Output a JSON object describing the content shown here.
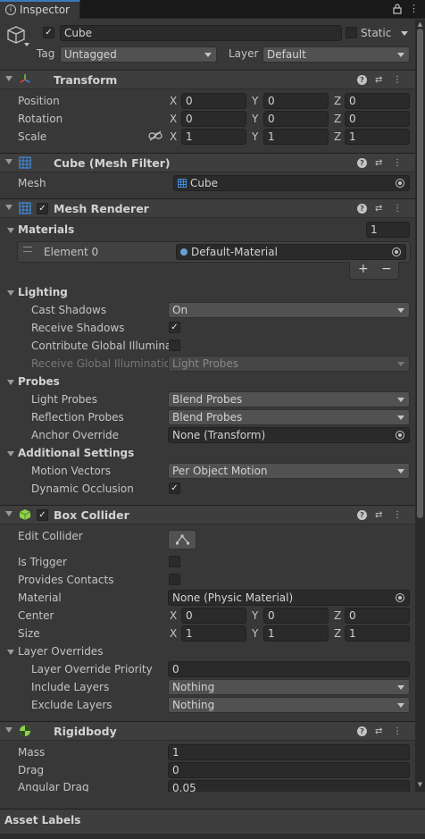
{
  "tab": {
    "title": "Inspector"
  },
  "header": {
    "object_name": "Cube",
    "static_label": "Static",
    "tag_label": "Tag",
    "tag_value": "Untagged",
    "layer_label": "Layer",
    "layer_value": "Default"
  },
  "transform": {
    "title": "Transform",
    "rows": [
      {
        "label": "Position",
        "x": "0",
        "y": "0",
        "z": "0"
      },
      {
        "label": "Rotation",
        "x": "0",
        "y": "0",
        "z": "0"
      },
      {
        "label": "Scale",
        "x": "1",
        "y": "1",
        "z": "1"
      }
    ]
  },
  "axes": {
    "x": "X",
    "y": "Y",
    "z": "Z"
  },
  "mesh_filter": {
    "title": "Cube (Mesh Filter)",
    "mesh_label": "Mesh",
    "mesh_value": "Cube"
  },
  "mesh_renderer": {
    "title": "Mesh Renderer",
    "materials_label": "Materials",
    "materials_count": "1",
    "element_label": "Element 0",
    "element_value": "Default-Material",
    "add": "+",
    "remove": "−",
    "lighting_label": "Lighting",
    "cast_shadows_label": "Cast Shadows",
    "cast_shadows_value": "On",
    "receive_shadows_label": "Receive Shadows",
    "contribute_gi_label": "Contribute Global Illuminati",
    "receive_gi_label": "Receive Global Illumination",
    "receive_gi_value": "Light Probes",
    "probes_label": "Probes",
    "light_probes_label": "Light Probes",
    "light_probes_value": "Blend Probes",
    "reflection_probes_label": "Reflection Probes",
    "reflection_probes_value": "Blend Probes",
    "anchor_override_label": "Anchor Override",
    "anchor_override_value": "None (Transform)",
    "additional_label": "Additional Settings",
    "motion_vectors_label": "Motion Vectors",
    "motion_vectors_value": "Per Object Motion",
    "dynamic_occlusion_label": "Dynamic Occlusion"
  },
  "box_collider": {
    "title": "Box Collider",
    "edit_collider_label": "Edit Collider",
    "is_trigger_label": "Is Trigger",
    "provides_contacts_label": "Provides Contacts",
    "material_label": "Material",
    "material_value": "None (Physic Material)",
    "center_label": "Center",
    "center": {
      "x": "0",
      "y": "0",
      "z": "0"
    },
    "size_label": "Size",
    "size": {
      "x": "1",
      "y": "1",
      "z": "1"
    },
    "layer_overrides_label": "Layer Overrides",
    "priority_label": "Layer Override Priority",
    "priority_value": "0",
    "include_label": "Include Layers",
    "include_value": "Nothing",
    "exclude_label": "Exclude Layers",
    "exclude_value": "Nothing"
  },
  "rigidbody": {
    "title": "Rigidbody",
    "mass_label": "Mass",
    "mass_value": "1",
    "drag_label": "Drag",
    "drag_value": "0",
    "angular_drag_label": "Angular Drag",
    "angular_drag_value": "0.05"
  },
  "asset_labels": {
    "title": "Asset Labels"
  },
  "icons": {
    "help": "?",
    "settings": "⇄",
    "more": "⋮",
    "check": "✓",
    "lock": "🔒"
  }
}
